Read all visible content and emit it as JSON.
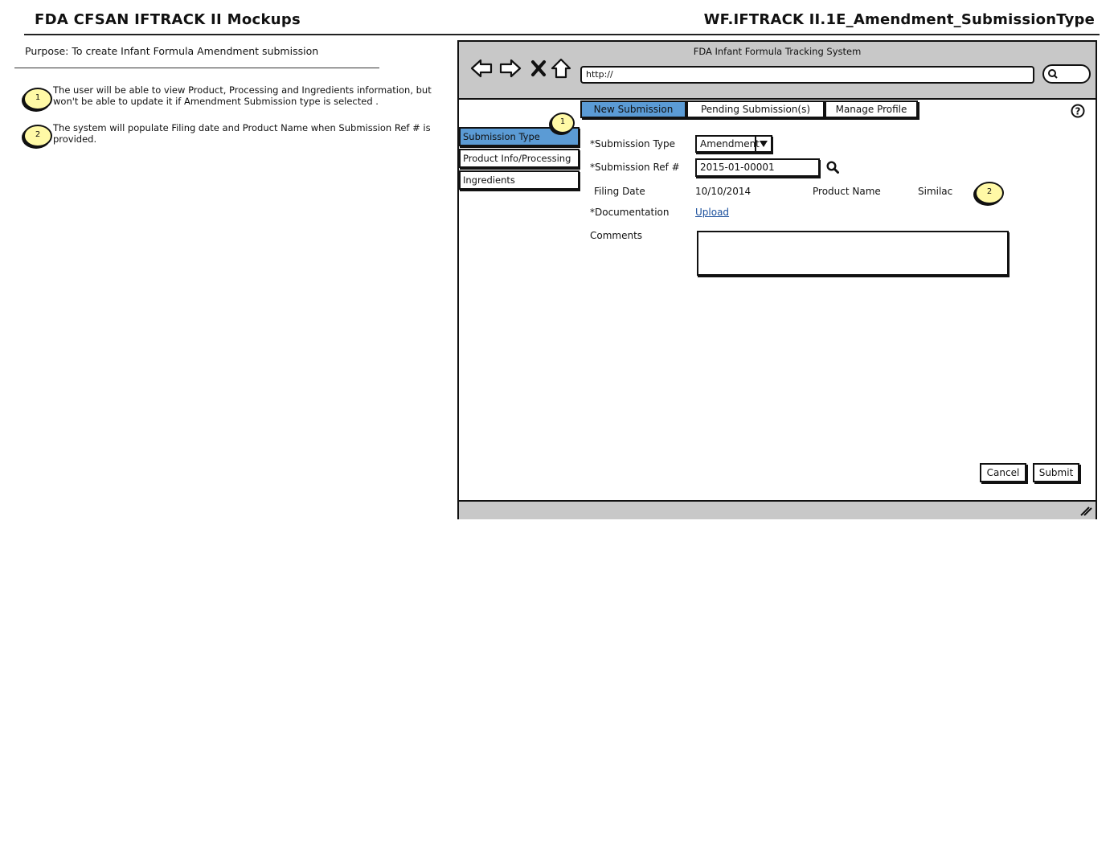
{
  "header": {
    "title": "FDA CFSAN IFTRACK II Mockups",
    "screen_id": "WF.IFTRACK II.1E_Amendment_SubmissionType"
  },
  "purpose": "Purpose: To create Infant Formula Amendment submission",
  "notes": [
    {
      "num": "1",
      "text": "The user will be able to view Product, Processing and Ingredients information, but won't be able to update it if Amendment Submission type is selected ."
    },
    {
      "num": "2",
      "text": "The system will populate Filing date and Product Name when Submission Ref # is provided."
    }
  ],
  "browser": {
    "window_title": "FDA Infant Formula Tracking System",
    "url": "http://",
    "icons": [
      "back-arrow-icon",
      "forward-arrow-icon",
      "stop-icon",
      "home-icon",
      "search-icon",
      "resize-grip-icon"
    ]
  },
  "tabs": [
    {
      "label": "New Submission",
      "active": true
    },
    {
      "label": "Pending Submission(s)",
      "active": false
    },
    {
      "label": "Manage Profile",
      "active": false
    }
  ],
  "sidebar": [
    {
      "label": "Submission Type",
      "active": true
    },
    {
      "label": "Product Info/Processing",
      "active": false
    },
    {
      "label": "Ingredients",
      "active": false
    }
  ],
  "form": {
    "submission_type_label": "*Submission Type",
    "submission_type_value": "Amendment",
    "submission_ref_label": "*Submission Ref #",
    "submission_ref_value": "2015-01-00001",
    "filing_date_label": "Filing Date",
    "filing_date_value": "10/10/2014",
    "product_name_label": "Product Name",
    "product_name_value": "Similac",
    "documentation_label": "*Documentation",
    "upload_link": "Upload",
    "comments_label": "Comments",
    "comments_value": ""
  },
  "buttons": {
    "cancel": "Cancel",
    "submit": "Submit"
  },
  "colors": {
    "active_tab": "#5b9bd5",
    "callout_fill": "#fff9a6",
    "chrome_gray": "#c8c8c8",
    "link": "#1a4f9c"
  }
}
